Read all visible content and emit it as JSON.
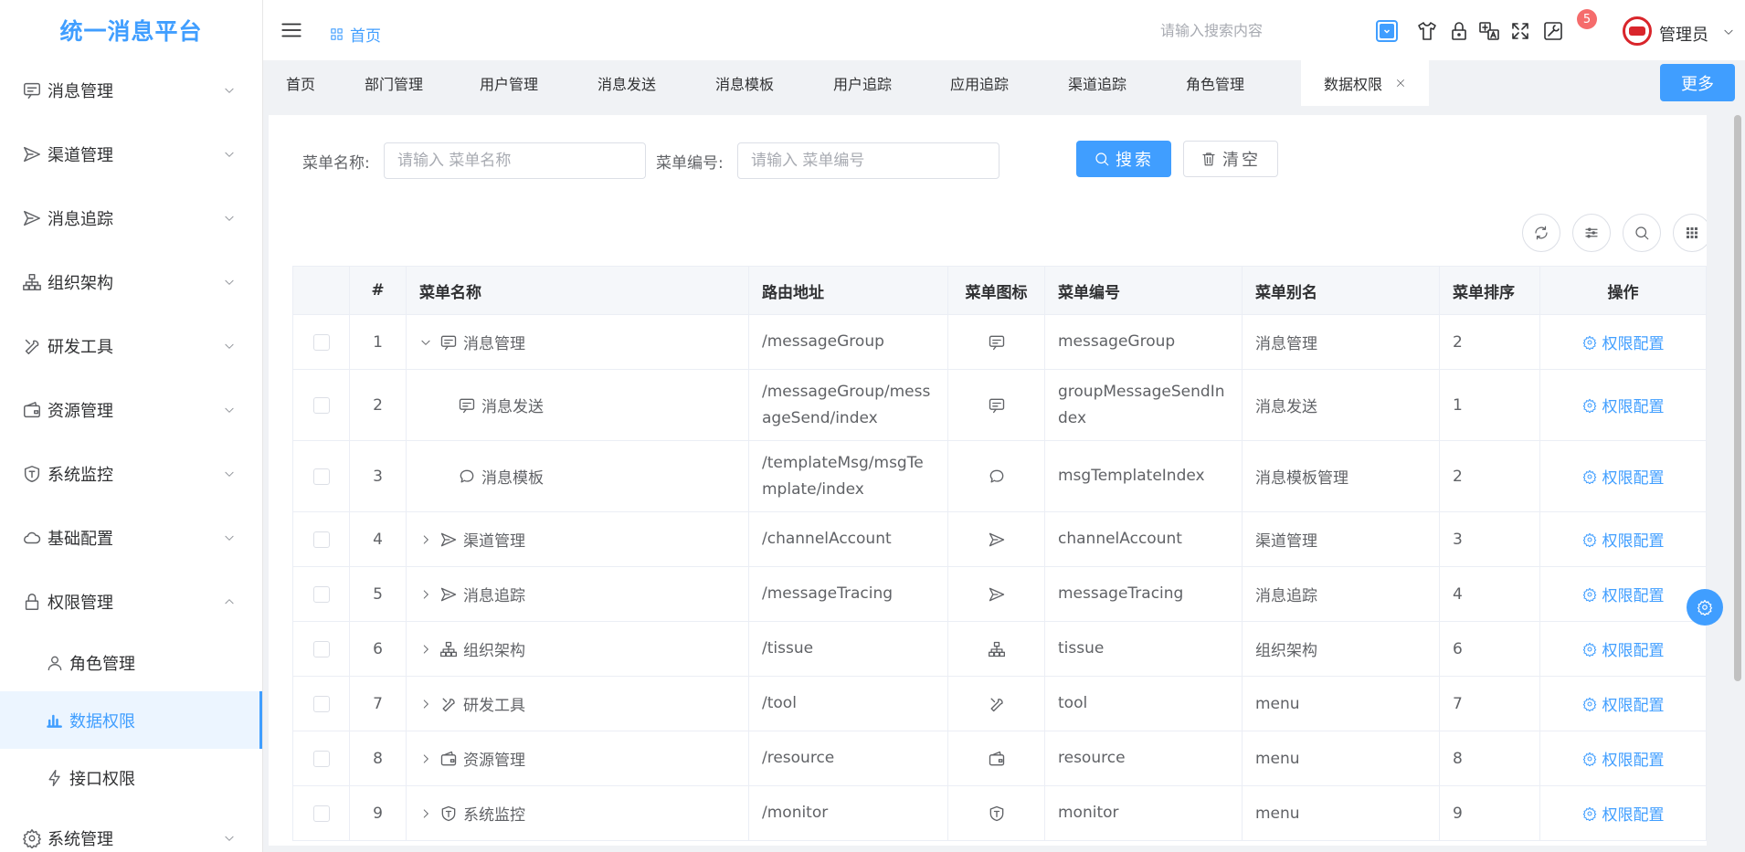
{
  "app": {
    "title": "统一消息平台"
  },
  "sidebar": {
    "items": [
      {
        "label": "消息管理",
        "icon": "message-icon"
      },
      {
        "label": "渠道管理",
        "icon": "send-icon"
      },
      {
        "label": "消息追踪",
        "icon": "send-icon"
      },
      {
        "label": "组织架构",
        "icon": "org-icon"
      },
      {
        "label": "研发工具",
        "icon": "tool-icon"
      },
      {
        "label": "资源管理",
        "icon": "wallet-icon"
      },
      {
        "label": "系统监控",
        "icon": "shield-icon"
      },
      {
        "label": "基础配置",
        "icon": "cloud-icon"
      },
      {
        "label": "权限管理",
        "icon": "lock-icon",
        "expanded": true
      }
    ],
    "sub_items": [
      {
        "label": "角色管理",
        "icon": "user-icon"
      },
      {
        "label": "数据权限",
        "icon": "chart-icon",
        "active": true
      },
      {
        "label": "接口权限",
        "icon": "bolt-icon"
      }
    ],
    "last_item": {
      "label": "系统管理",
      "icon": "gear-icon"
    }
  },
  "header": {
    "breadcrumb": "首页",
    "search_placeholder": "请输入搜索内容",
    "badge_count": "5",
    "username": "管理员"
  },
  "tabs": {
    "items": [
      "首页",
      "部门管理",
      "用户管理",
      "消息发送",
      "消息模板",
      "用户追踪",
      "应用追踪",
      "渠道追踪",
      "角色管理",
      "数据权限"
    ],
    "active": "数据权限",
    "more_label": "更多"
  },
  "filter": {
    "name_label": "菜单名称:",
    "name_placeholder": "请输入 菜单名称",
    "code_label": "菜单编号:",
    "code_placeholder": "请输入 菜单编号",
    "search_label": "搜索",
    "clear_label": "清空"
  },
  "table": {
    "columns": [
      "",
      "#",
      "菜单名称",
      "路由地址",
      "菜单图标",
      "菜单编号",
      "菜单别名",
      "菜单排序",
      "操作"
    ],
    "rows": [
      {
        "index": "1",
        "name": "消息管理",
        "route": "/messageGroup",
        "code": "messageGroup",
        "alias": "消息管理",
        "sort": "2",
        "icon": "message-icon",
        "expand": "expanded",
        "level": 0
      },
      {
        "index": "2",
        "name": "消息发送",
        "route": "/messageGroup/messageSend/index",
        "code": "groupMessageSendIndex",
        "alias": "消息发送",
        "sort": "1",
        "icon": "message-icon",
        "expand": "none",
        "level": 1
      },
      {
        "index": "3",
        "name": "消息模板",
        "route": "/templateMsg/msgTemplate/index",
        "code": "msgTemplateIndex",
        "alias": "消息模板管理",
        "sort": "2",
        "icon": "bubble-icon",
        "expand": "none",
        "level": 1
      },
      {
        "index": "4",
        "name": "渠道管理",
        "route": "/channelAccount",
        "code": "channelAccount",
        "alias": "渠道管理",
        "sort": "3",
        "icon": "send-icon",
        "expand": "collapsed",
        "level": 0
      },
      {
        "index": "5",
        "name": "消息追踪",
        "route": "/messageTracing",
        "code": "messageTracing",
        "alias": "消息追踪",
        "sort": "4",
        "icon": "send-icon",
        "expand": "collapsed",
        "level": 0
      },
      {
        "index": "6",
        "name": "组织架构",
        "route": "/tissue",
        "code": "tissue",
        "alias": "组织架构",
        "sort": "6",
        "icon": "org-icon",
        "expand": "collapsed",
        "level": 0
      },
      {
        "index": "7",
        "name": "研发工具",
        "route": "/tool",
        "code": "tool",
        "alias": "menu",
        "sort": "7",
        "icon": "tool-icon",
        "expand": "collapsed",
        "level": 0
      },
      {
        "index": "8",
        "name": "资源管理",
        "route": "/resource",
        "code": "resource",
        "alias": "menu",
        "sort": "8",
        "icon": "wallet-icon",
        "expand": "collapsed",
        "level": 0
      },
      {
        "index": "9",
        "name": "系统监控",
        "route": "/monitor",
        "code": "monitor",
        "alias": "menu",
        "sort": "9",
        "icon": "shield-icon",
        "expand": "collapsed",
        "level": 0
      }
    ],
    "action_label": "权限配置"
  },
  "colors": {
    "primary": "#409eff",
    "badge": "#f56c6c"
  }
}
